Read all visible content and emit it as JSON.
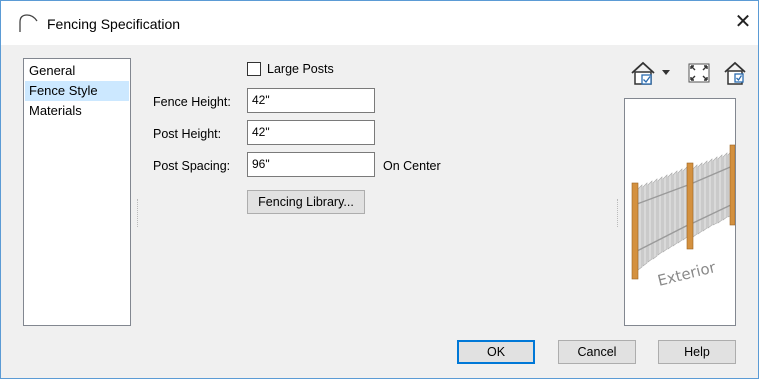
{
  "window": {
    "title": "Fencing Specification",
    "close_symbol": "✕"
  },
  "nav": {
    "items": [
      {
        "label": "General",
        "selected": false
      },
      {
        "label": "Fence Style",
        "selected": true
      },
      {
        "label": "Materials",
        "selected": false
      }
    ]
  },
  "form": {
    "large_posts": {
      "label": "Large Posts",
      "checked": false
    },
    "fence_height": {
      "label": "Fence Height:",
      "value": "42\""
    },
    "post_height": {
      "label": "Post Height:",
      "value": "42\""
    },
    "post_spacing": {
      "label": "Post Spacing:",
      "value": "96\"",
      "unit": "On Center"
    },
    "library_button": "Fencing Library..."
  },
  "toolbar": {
    "icons": [
      "house-view-icon",
      "fill-window-icon",
      "show-in-view-icon"
    ]
  },
  "preview": {
    "caption": "Exterior",
    "icon": "fence-3d-preview"
  },
  "buttons": {
    "ok": "OK",
    "cancel": "Cancel",
    "help": "Help"
  },
  "colors": {
    "selection": "#cce8ff",
    "accent": "#0078d7",
    "post": "#d4913f",
    "picket": "#c8c8c8"
  }
}
